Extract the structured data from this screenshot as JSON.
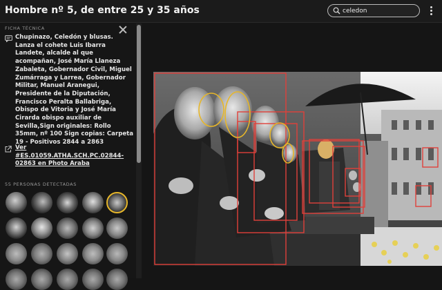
{
  "header": {
    "title": "Hombre nº 5, de entre 25 y 35 años",
    "search_value": "celedon",
    "more_label": "more-options"
  },
  "sidebar": {
    "section_title": "FICHA TÉCNICA",
    "description": "Chupinazo, Celedón y blusas. Lanza el cohete Luis Ibarra Landete, alcalde al que acompañan, José María Llaneza Zabaleta, Gobernador Civil, Miguel Zumárraga y Larrea, Gobernador Militar, Manuel Aranegui, Presidente de la Diputación, Francisco Peralta Ballabriga, Obispo de Vitoria y José María Cirarda obispo auxiliar de Sevilla,Sign originales: Rollo 35mm, nº 100 Sign copias: Carpeta 19 - Positivos 2844 a 2863",
    "link_text": "Ver #ES.01059.ATHA.SCH.PC.02844-02863 en Photo Araba",
    "detected_title": "55 PERSONAS DETECTADAS"
  },
  "colors": {
    "accent_face_box": "#e0403a",
    "selected_face": "#e6b62a",
    "background": "#151515"
  }
}
